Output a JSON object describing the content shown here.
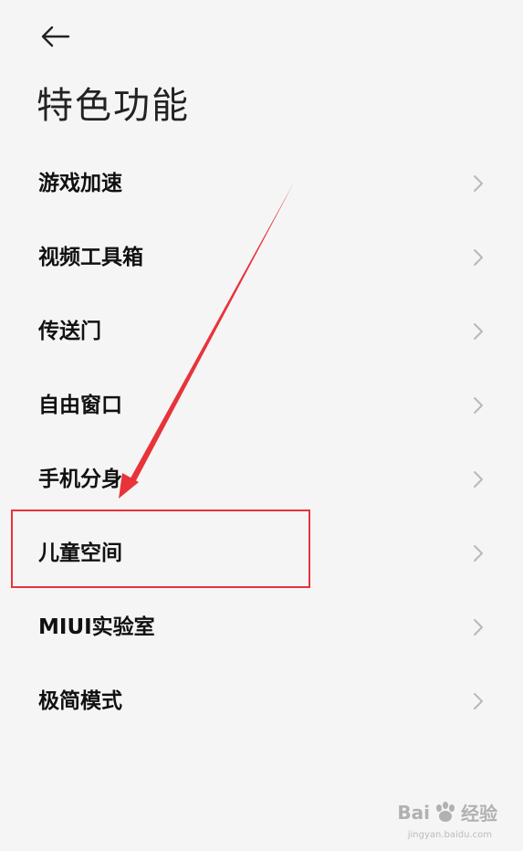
{
  "header": {
    "back_icon": "arrow-left-icon",
    "title": "特色功能"
  },
  "list": {
    "items": [
      {
        "label": "游戏加速",
        "icon": "chevron-right-icon"
      },
      {
        "label": "视频工具箱",
        "icon": "chevron-right-icon"
      },
      {
        "label": "传送门",
        "icon": "chevron-right-icon"
      },
      {
        "label": "自由窗口",
        "icon": "chevron-right-icon"
      },
      {
        "label": "手机分身",
        "icon": "chevron-right-icon"
      },
      {
        "label": "儿童空间",
        "icon": "chevron-right-icon"
      },
      {
        "label": "MIUI实验室",
        "icon": "chevron-right-icon"
      },
      {
        "label": "极简模式",
        "icon": "chevron-right-icon"
      }
    ]
  },
  "annotation": {
    "highlight_color": "#e8333a",
    "highlighted_item": "儿童空间",
    "arrow_color": "#e8333a"
  },
  "watermark": {
    "brand": "Bai",
    "brand2": "经验",
    "sub": "jingyan.baidu.com"
  },
  "colors": {
    "background": "#f5f5f5",
    "text": "#111111",
    "chevron": "#b8b8b8"
  }
}
